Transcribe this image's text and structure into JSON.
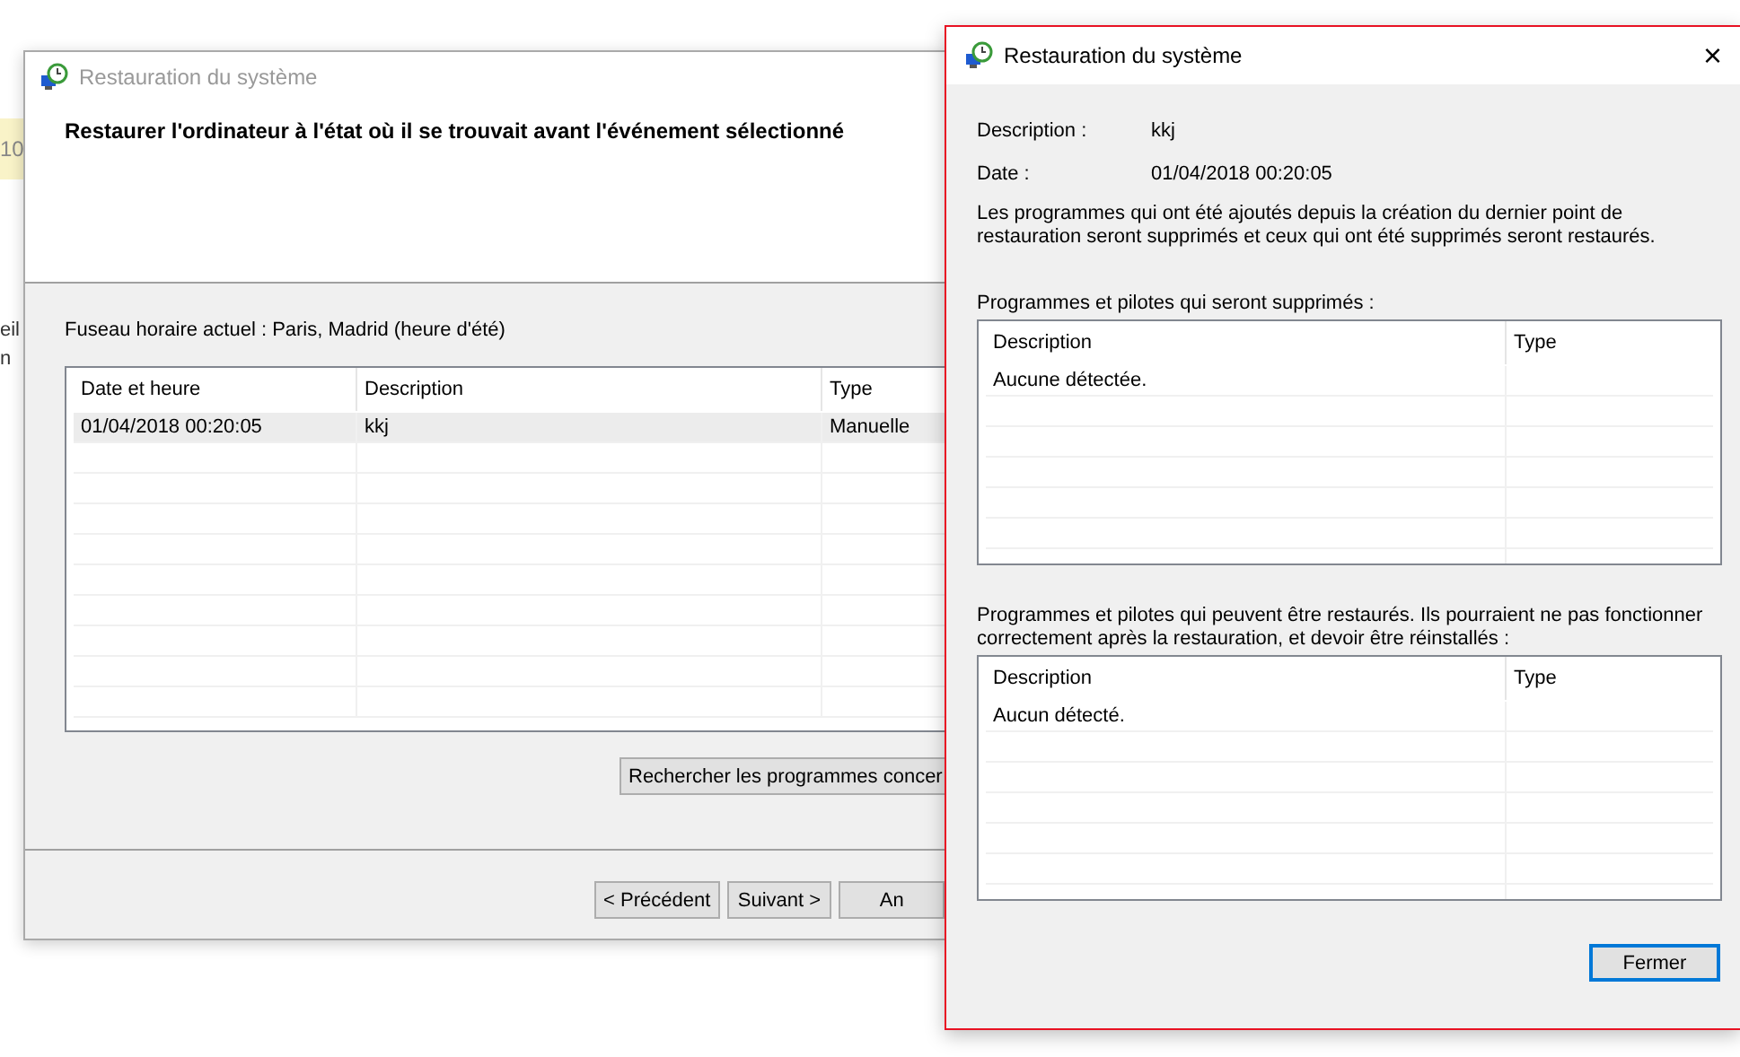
{
  "background_window": {
    "fragments": [
      "10",
      "eil",
      "n"
    ]
  },
  "wizard": {
    "title": "Restauration du système",
    "heading": "Restaurer l'ordinateur à l'état où il se trouvait avant l'événement sélectionné",
    "timezone": "Fuseau horaire actuel : Paris, Madrid (heure d'été)",
    "table": {
      "columns": [
        "Date et heure",
        "Description",
        "Type"
      ],
      "rows": [
        {
          "cells": [
            "01/04/2018 00:20:05",
            "kkj",
            "Manuelle"
          ],
          "selected": true
        }
      ]
    },
    "scan_button": "Rechercher les programmes concer",
    "buttons": [
      "< Précédent",
      "Suivant >",
      "An"
    ]
  },
  "dialog": {
    "title": "Restauration du système",
    "close": "×",
    "fields": [
      {
        "label": "Description :",
        "value": "kkj"
      },
      {
        "label": "Date :",
        "value": "01/04/2018 00:20:05"
      }
    ],
    "note": "Les programmes qui ont été ajoutés depuis la création du dernier point de restauration seront supprimés et ceux qui ont été supprimés seront restaurés.",
    "sections": [
      {
        "label": "Programmes et pilotes qui seront supprimés :",
        "columns": [
          "Description",
          "Type"
        ],
        "rows": [
          [
            "Aucune détectée.",
            ""
          ]
        ]
      },
      {
        "label": "Programmes et pilotes qui peuvent être restaurés. Ils pourraient ne pas fonctionner correctement après la restauration, et devoir être réinstallés :",
        "columns": [
          "Description",
          "Type"
        ],
        "rows": [
          [
            "Aucun détecté.",
            ""
          ]
        ]
      }
    ],
    "button": "Fermer"
  }
}
